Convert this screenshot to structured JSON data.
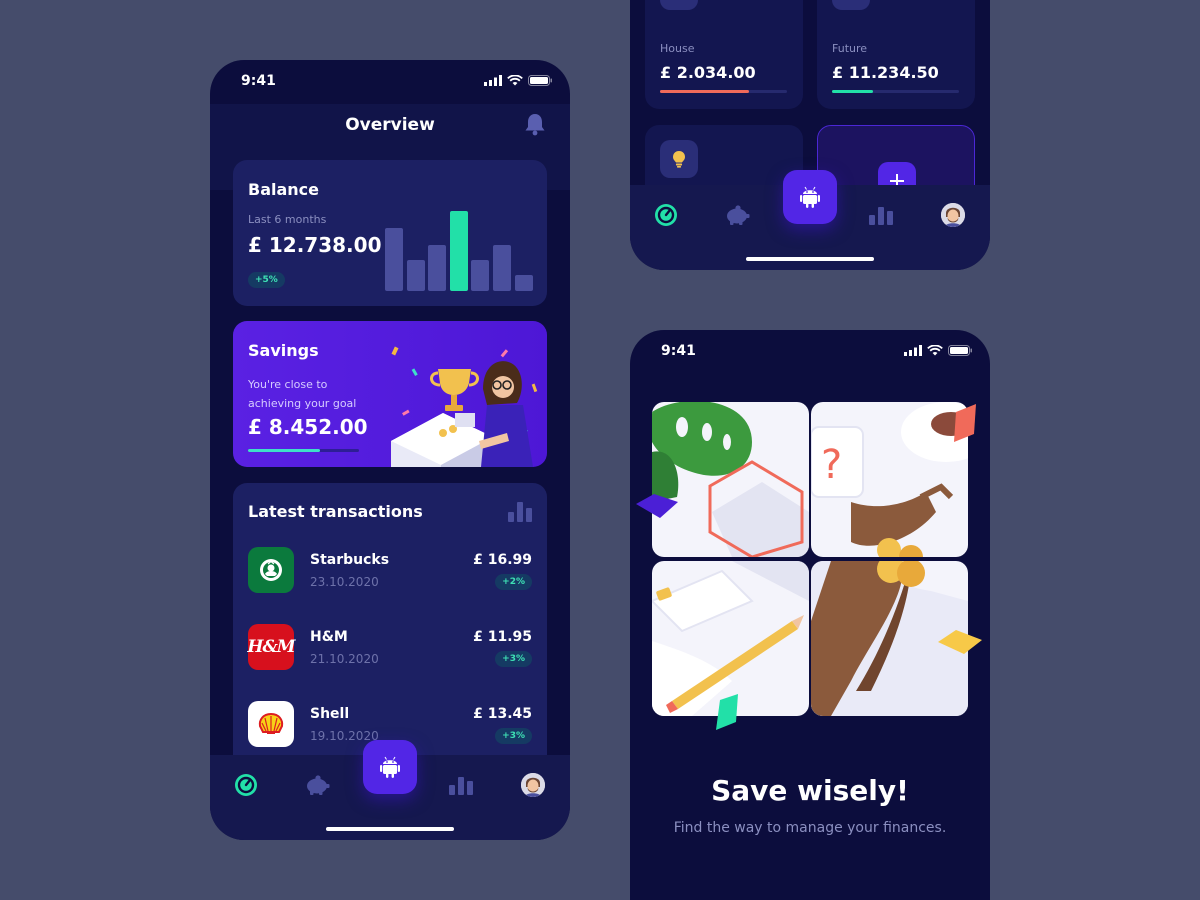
{
  "main_screen": {
    "status_time": "9:41",
    "title": "Overview",
    "balance": {
      "title": "Balance",
      "period": "Last 6 months",
      "amount": "£ 12.738.00",
      "change": "+5%",
      "bar_levels": [
        0.79,
        0.39,
        0.57,
        1.0,
        0.39,
        0.57,
        0.2
      ],
      "highlight_index": 3,
      "bar_color": "#4a4f9d",
      "highlight_color": "#22e0a8"
    },
    "savings": {
      "title": "Savings",
      "subtitle": "You're close to achieving your goal",
      "amount": "£ 8.452.00",
      "progress": 0.65
    },
    "transactions": {
      "title": "Latest transactions",
      "items": [
        {
          "name": "Starbucks",
          "date": "23.10.2020",
          "amount": "£ 16.99",
          "change": "+2%",
          "logo_color": "#0b7a3d",
          "logo": "starbucks-logo"
        },
        {
          "name": "H&M",
          "date": "21.10.2020",
          "amount": "£ 11.95",
          "change": "+3%",
          "logo_color": "#d7101d",
          "logo": "hm-logo",
          "logo_text": "H&M"
        },
        {
          "name": "Shell",
          "date": "19.10.2020",
          "amount": "£ 13.45",
          "change": "+3%",
          "logo_color": "#ffffff",
          "logo": "shell-logo"
        }
      ]
    }
  },
  "goals_screen": {
    "goals": [
      {
        "label": "House",
        "amount": "£ 2.034.00",
        "progress": 0.7,
        "color": "#f06a5a"
      },
      {
        "label": "Future",
        "amount": "£ 11.234.50",
        "progress": 0.32,
        "color": "#22e0a8"
      }
    ]
  },
  "onboarding_screen": {
    "status_time": "9:41",
    "headline": "Save wisely!",
    "subline": "Find the way to manage your finances."
  },
  "colors": {
    "background": "#454c6b",
    "phone": "#0c0d3d",
    "card": "#1c2063",
    "accent": "#5226e6",
    "mint": "#22e0a8"
  }
}
